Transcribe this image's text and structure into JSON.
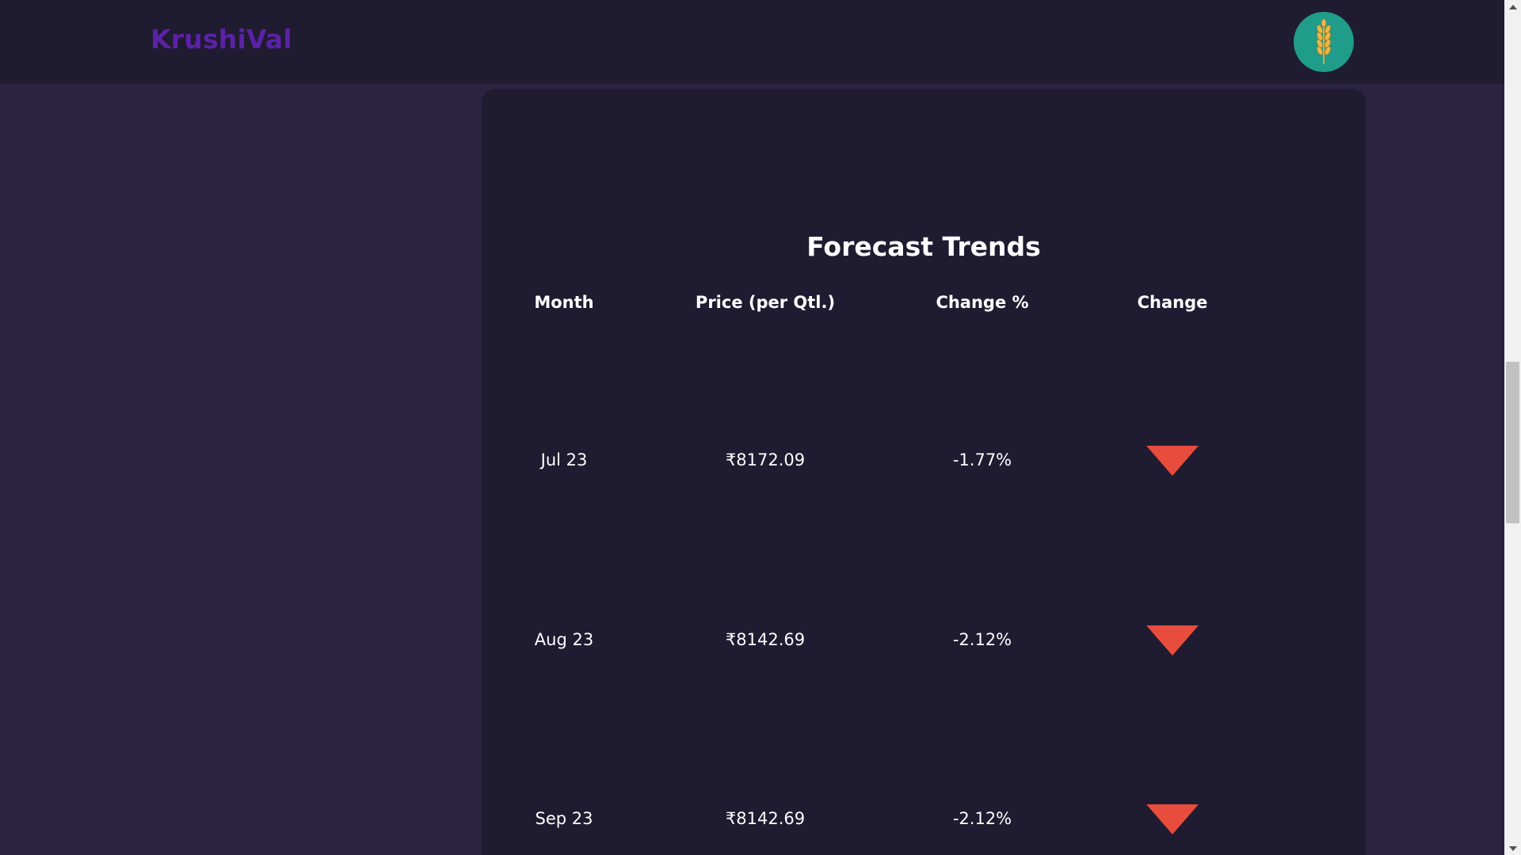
{
  "header": {
    "brand": "KrushiVal",
    "brand_color": "#5b21a6",
    "avatar_icon": "wheat-icon",
    "avatar_bg": "#1f9c8a"
  },
  "forecast": {
    "title": "Forecast Trends",
    "columns": {
      "month": "Month",
      "price": "Price (per Qtl.)",
      "change_pct": "Change %",
      "change": "Change"
    },
    "rows": [
      {
        "month": "Jul 23",
        "price": "₹8172.09",
        "change_pct": "-1.77%",
        "change_icon": "down-arrow-icon"
      },
      {
        "month": "Aug 23",
        "price": "₹8142.69",
        "change_pct": "-2.12%",
        "change_icon": "down-arrow-icon"
      },
      {
        "month": "Sep 23",
        "price": "₹8142.69",
        "change_pct": "-2.12%",
        "change_icon": "down-arrow-icon"
      }
    ],
    "down_color": "#e74c3c"
  }
}
